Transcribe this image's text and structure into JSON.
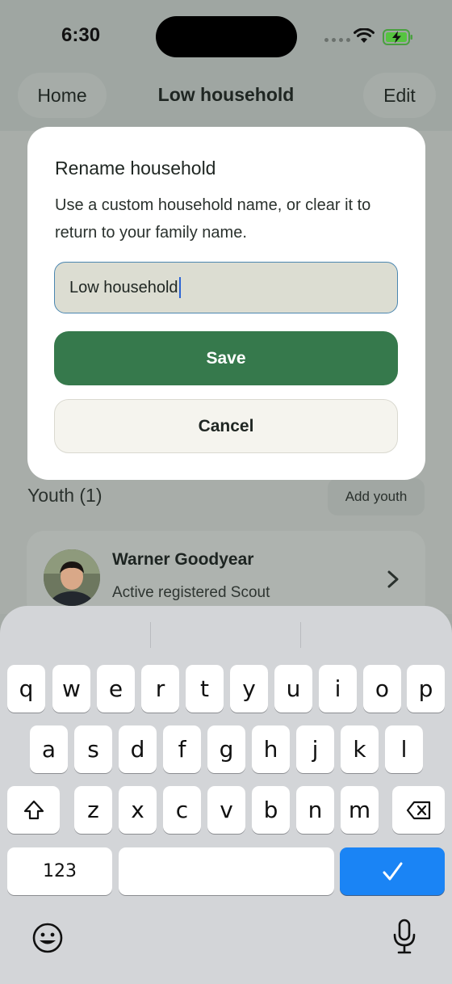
{
  "status_bar": {
    "time": "6:30"
  },
  "nav": {
    "back_label": "Home",
    "title": "Low household",
    "edit_label": "Edit"
  },
  "dialog": {
    "title": "Rename household",
    "message": "Use a custom household name, or clear it to return to your family name.",
    "input_value": "Low household",
    "save_label": "Save",
    "cancel_label": "Cancel"
  },
  "youth_section": {
    "title": "Youth (1)",
    "add_label": "Add youth",
    "items": [
      {
        "name": "Warner Goodyear",
        "status": "Active registered Scout"
      }
    ]
  },
  "keyboard": {
    "row1": [
      "q",
      "w",
      "e",
      "r",
      "t",
      "y",
      "u",
      "i",
      "o",
      "p"
    ],
    "row2": [
      "a",
      "s",
      "d",
      "f",
      "g",
      "h",
      "j",
      "k",
      "l"
    ],
    "row3": [
      "z",
      "x",
      "c",
      "v",
      "b",
      "n",
      "m"
    ],
    "numbers_label": "123",
    "done_icon": "checkmark-icon"
  },
  "colors": {
    "primary_green": "#36794c",
    "keyboard_accent": "#1a84f5",
    "input_focus_border": "#4a86b0"
  }
}
